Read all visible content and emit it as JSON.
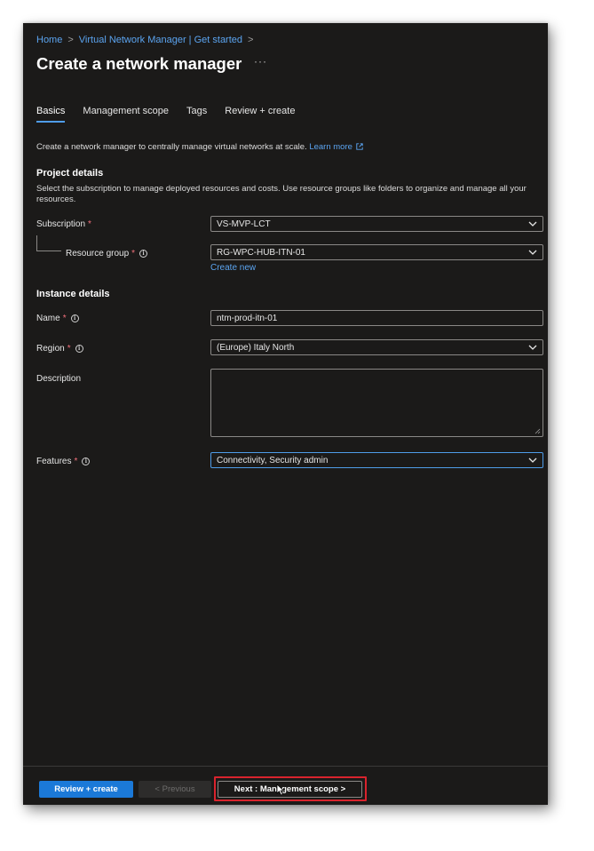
{
  "breadcrumb": [
    "Home",
    "Virtual Network Manager | Get started"
  ],
  "page_title": "Create a network manager",
  "more_label": "···",
  "tabs": [
    {
      "label": "Basics",
      "active": true
    },
    {
      "label": "Management scope",
      "active": false
    },
    {
      "label": "Tags",
      "active": false
    },
    {
      "label": "Review + create",
      "active": false
    }
  ],
  "intro": {
    "text": "Create a network manager to centrally manage virtual networks at scale.",
    "link": "Learn more"
  },
  "project": {
    "title": "Project details",
    "description": "Select the subscription to manage deployed resources and costs. Use resource groups like folders to organize and manage all your resources.",
    "subscription_label": "Subscription",
    "subscription_value": "VS-MVP-LCT",
    "resource_group_label": "Resource group",
    "resource_group_value": "RG-WPC-HUB-ITN-01",
    "create_new": "Create new"
  },
  "instance": {
    "title": "Instance details",
    "name_label": "Name",
    "name_value": "ntm-prod-itn-01",
    "region_label": "Region",
    "region_value": "(Europe) Italy North",
    "description_label": "Description",
    "features_label": "Features",
    "features_value": "Connectivity, Security admin"
  },
  "footer": {
    "review_create": "Review + create",
    "previous": "< Previous",
    "next": "Next : Management scope >"
  },
  "colors": {
    "background": "#1b1a19",
    "accent": "#1b79d8",
    "link": "#5ba4f0",
    "required": "#f1707b",
    "highlight": "#d9232d"
  },
  "icons": {
    "breadcrumb_separator": "chevron-right-icon",
    "info": "info-icon",
    "dropdown": "chevron-down-icon",
    "external": "external-link-icon",
    "cursor": "mouse-cursor-icon"
  }
}
